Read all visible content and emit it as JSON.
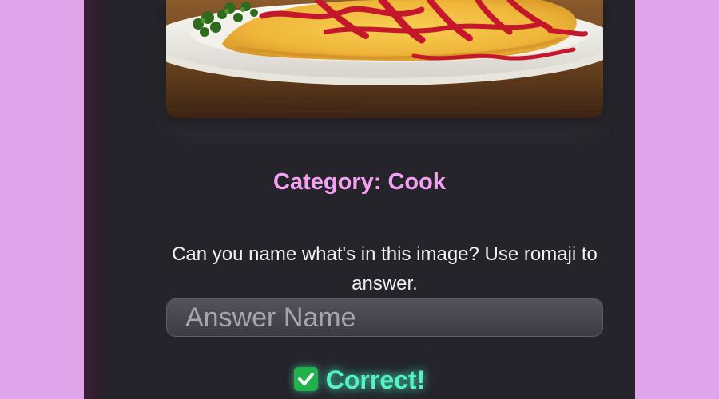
{
  "quiz": {
    "image_alt": "omelette rice with ketchup",
    "category": "Category: Cook",
    "question": "Can you name what's in this image? Use romaji to answer.",
    "answer_placeholder": "Answer Name",
    "answer_value": "",
    "result_text": "Correct!",
    "result_icon": "check-icon"
  },
  "colors": {
    "page_bg": "#e0a4ea",
    "panel_bg": "#25242b",
    "category": "#f4a0f3",
    "result": "#57f2c4"
  }
}
